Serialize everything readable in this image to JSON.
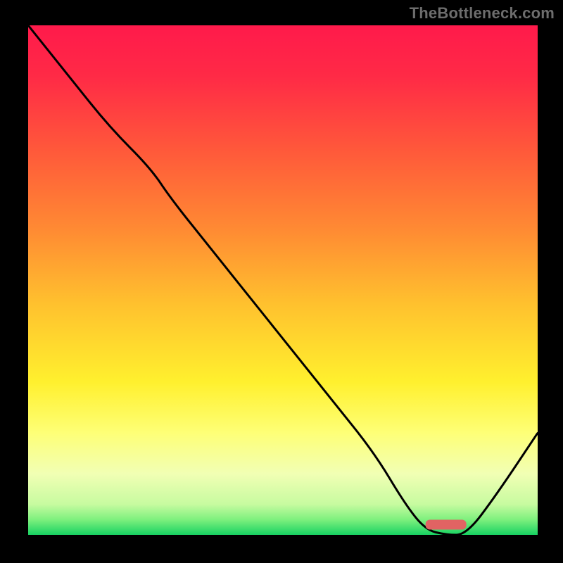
{
  "watermark": "TheBottleneck.com",
  "colors": {
    "frame": "#000000",
    "watermark": "#6d6d6d",
    "curve": "#000000",
    "marker": "#e16363",
    "gradient_stops": [
      {
        "offset": 0,
        "color": "#ff1a4b"
      },
      {
        "offset": 10,
        "color": "#ff2a46"
      },
      {
        "offset": 25,
        "color": "#ff5a3a"
      },
      {
        "offset": 40,
        "color": "#ff8a33"
      },
      {
        "offset": 55,
        "color": "#ffc22e"
      },
      {
        "offset": 70,
        "color": "#fff02e"
      },
      {
        "offset": 80,
        "color": "#feff77"
      },
      {
        "offset": 88,
        "color": "#f1ffb4"
      },
      {
        "offset": 94,
        "color": "#c7fba0"
      },
      {
        "offset": 97,
        "color": "#7ef07e"
      },
      {
        "offset": 100,
        "color": "#18d262"
      }
    ]
  },
  "chart_data": {
    "type": "line",
    "title": "",
    "xlabel": "",
    "ylabel": "",
    "xlim": [
      0,
      100
    ],
    "ylim": [
      0,
      100
    ],
    "grid": false,
    "annotations": [],
    "legend": [],
    "series": [
      {
        "name": "bottleneck-curve",
        "x": [
          0,
          8,
          16,
          24,
          28,
          36,
          44,
          52,
          60,
          68,
          74,
          78,
          82,
          86,
          92,
          100
        ],
        "y": [
          100,
          90,
          80,
          72,
          66,
          56,
          46,
          36,
          26,
          16,
          6,
          1,
          0,
          0,
          8,
          20
        ]
      }
    ],
    "marker": {
      "x_start": 78,
      "x_end": 86,
      "y": 2,
      "thickness": 2
    }
  }
}
